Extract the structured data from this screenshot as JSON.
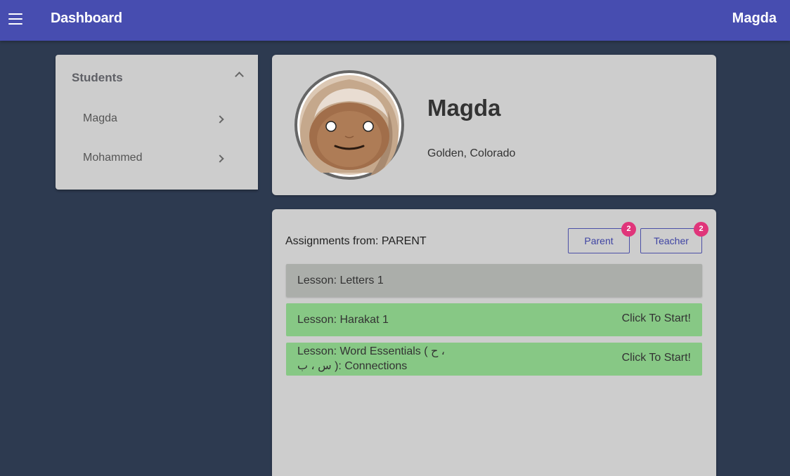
{
  "appbar": {
    "title": "Dashboard",
    "user": "Magda",
    "color": "#474db0"
  },
  "sidebar": {
    "title": "Students",
    "items": [
      {
        "label": "Magda"
      },
      {
        "label": "Mohammed"
      }
    ]
  },
  "profile": {
    "name": "Magda",
    "location": "Golden, Colorado"
  },
  "assignments": {
    "label": "Assignments from: PARENT",
    "tabs": [
      {
        "label": "Parent",
        "badge": "2"
      },
      {
        "label": "Teacher",
        "badge": "2"
      }
    ],
    "lessons": [
      {
        "name": "Lesson: Letters 1",
        "action": "",
        "status": "done"
      },
      {
        "name": "Lesson: Harakat 1",
        "action": "Click To Start!",
        "status": "todo"
      },
      {
        "name_line1": "Lesson: Word Essentials ( ح ،",
        "name_line2": "س ، ب ): Connections",
        "action": "Click To Start!",
        "status": "todo"
      }
    ]
  },
  "colors": {
    "background": "#2d3a50",
    "card": "#cdcdcd",
    "done": "#abaeaa",
    "todo": "#87c885",
    "badge": "#e0357a"
  }
}
